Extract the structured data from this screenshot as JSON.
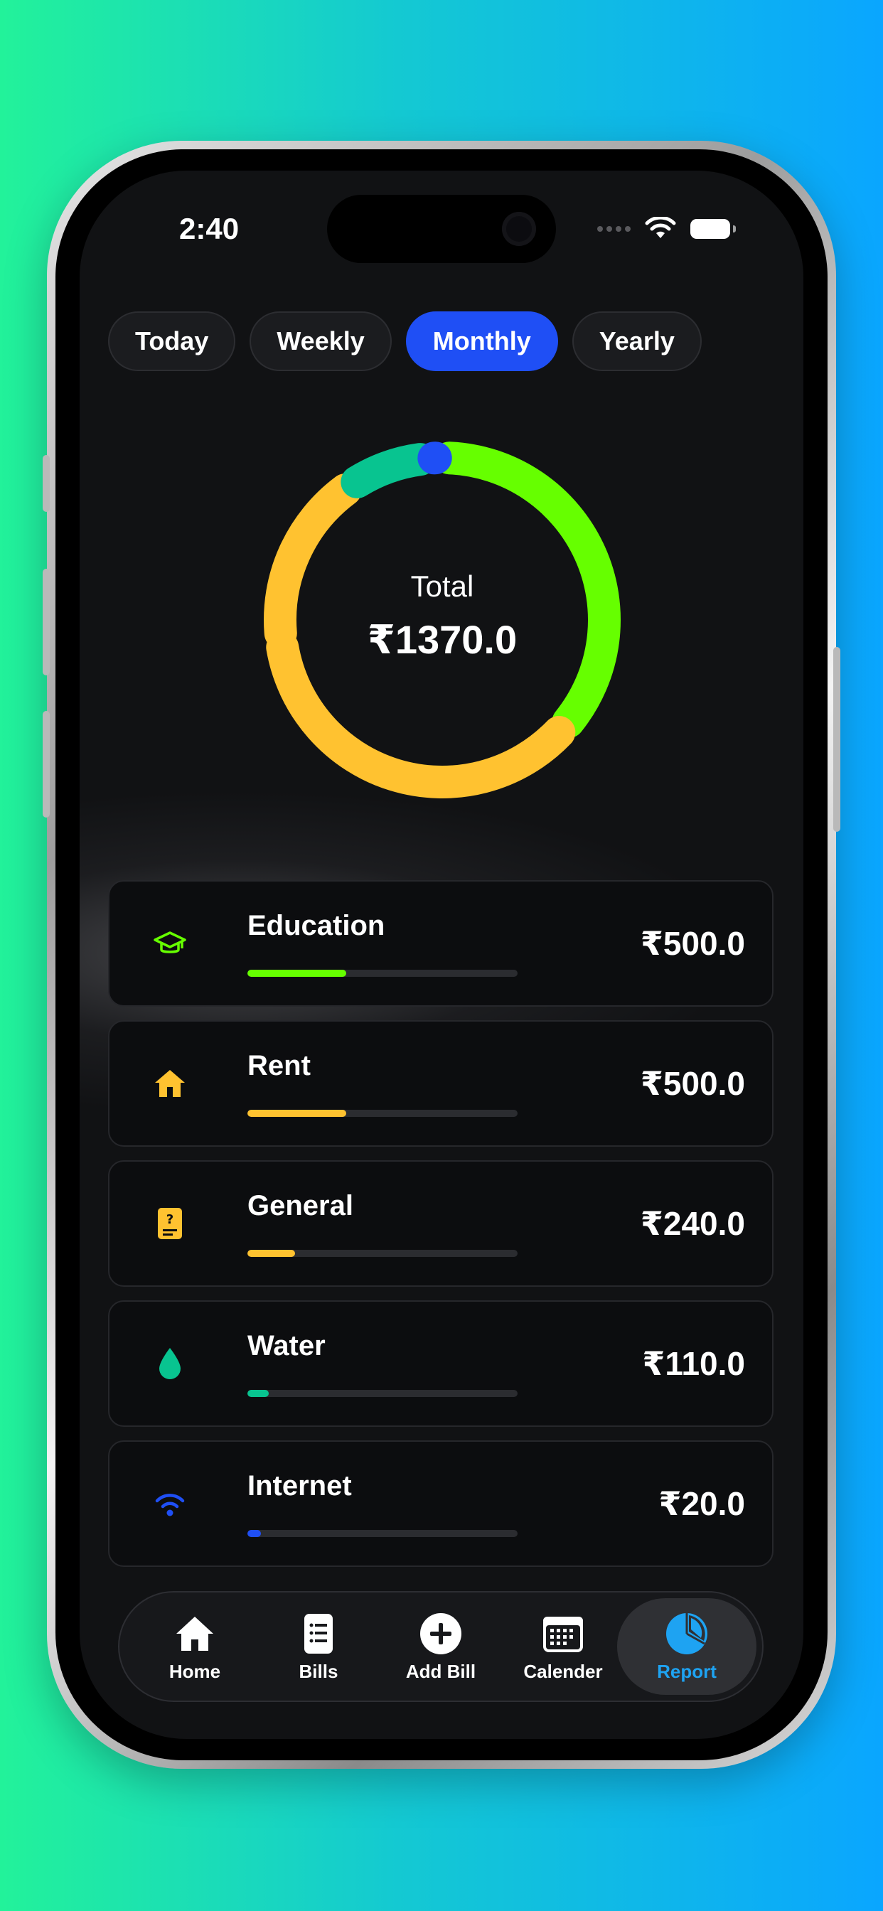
{
  "status_bar": {
    "time": "2:40"
  },
  "period_tabs": [
    {
      "label": "Today",
      "active": false
    },
    {
      "label": "Weekly",
      "active": false
    },
    {
      "label": "Monthly",
      "active": true
    },
    {
      "label": "Yearly",
      "active": false
    }
  ],
  "summary": {
    "label": "Total",
    "total": "₹1370.0"
  },
  "chart_data": {
    "type": "pie",
    "style": "donut",
    "categories": [
      "Education",
      "Rent",
      "General",
      "Water",
      "Internet"
    ],
    "values": [
      500,
      500,
      240,
      110,
      20
    ],
    "colors": [
      "#66ff00",
      "#ffc230",
      "#ffc230",
      "#08c490",
      "#1f4ff5"
    ]
  },
  "categories": [
    {
      "name": "Education",
      "amount": "₹500.0",
      "share": 0.365,
      "color": "#66ff00",
      "icon": "graduation-cap-icon"
    },
    {
      "name": "Rent",
      "amount": "₹500.0",
      "share": 0.365,
      "color": "#ffc230",
      "icon": "house-icon"
    },
    {
      "name": "General",
      "amount": "₹240.0",
      "share": 0.175,
      "color": "#ffc230",
      "icon": "question-document-icon"
    },
    {
      "name": "Water",
      "amount": "₹110.0",
      "share": 0.08,
      "color": "#08c490",
      "icon": "water-drop-icon"
    },
    {
      "name": "Internet",
      "amount": "₹20.0",
      "share": 0.05,
      "color": "#1f4ff5",
      "icon": "wifi-icon"
    }
  ],
  "bottom_nav": [
    {
      "label": "Home",
      "icon": "home-icon",
      "active": false
    },
    {
      "label": "Bills",
      "icon": "bills-list-icon",
      "active": false
    },
    {
      "label": "Add Bill",
      "icon": "add-circle-icon",
      "active": false
    },
    {
      "label": "Calender",
      "icon": "calendar-icon",
      "active": false
    },
    {
      "label": "Report",
      "icon": "pie-chart-icon",
      "active": true
    }
  ],
  "colors": {
    "accent": "#1f4ff5",
    "report_active": "#1ea3f2",
    "background": "#111214"
  }
}
